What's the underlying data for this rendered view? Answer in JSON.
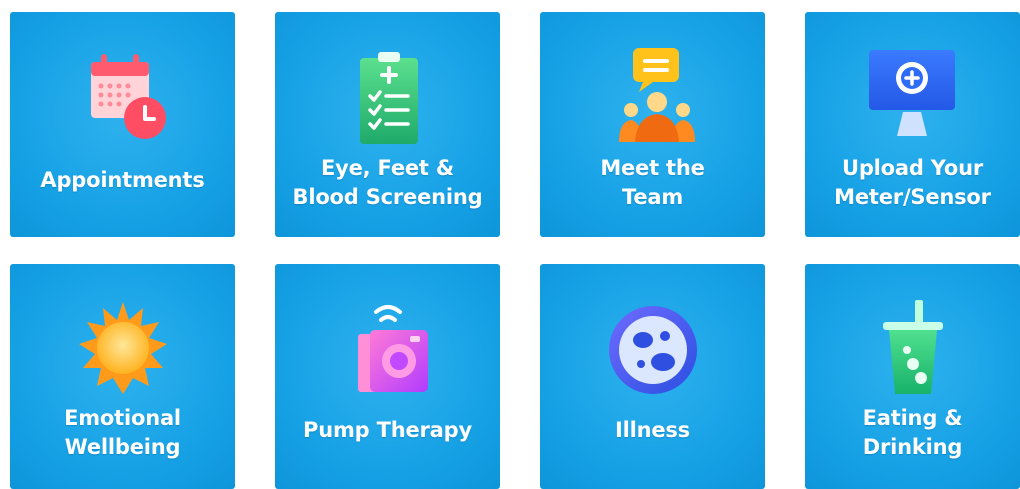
{
  "tiles": [
    {
      "id": "appointments",
      "lines": [
        "Appointments"
      ],
      "icon": "calendar-clock-icon"
    },
    {
      "id": "screening",
      "lines": [
        "Eye, Feet &",
        "Blood Screening"
      ],
      "icon": "clipboard-checklist-icon"
    },
    {
      "id": "team",
      "lines": [
        "Meet the",
        "Team"
      ],
      "icon": "team-chat-icon"
    },
    {
      "id": "upload",
      "lines": [
        "Upload Your",
        "Meter/Sensor"
      ],
      "icon": "monitor-upload-icon"
    },
    {
      "id": "wellbeing",
      "lines": [
        "Emotional",
        "Wellbeing"
      ],
      "icon": "sun-icon"
    },
    {
      "id": "pump",
      "lines": [
        "Pump Therapy"
      ],
      "icon": "pump-device-icon"
    },
    {
      "id": "illness",
      "lines": [
        "Illness"
      ],
      "icon": "virus-cell-icon"
    },
    {
      "id": "eating",
      "lines": [
        "Eating &",
        "Drinking"
      ],
      "icon": "drink-cup-icon"
    }
  ],
  "colors": {
    "tile_bg": "#17a2e6",
    "label_text": "#ffffff"
  }
}
